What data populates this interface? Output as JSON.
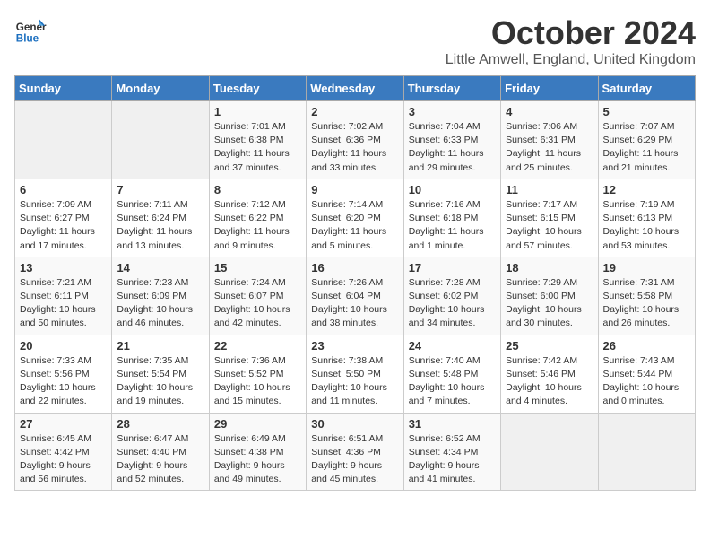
{
  "header": {
    "logo_line1": "General",
    "logo_line2": "Blue",
    "month": "October 2024",
    "location": "Little Amwell, England, United Kingdom"
  },
  "days_of_week": [
    "Sunday",
    "Monday",
    "Tuesday",
    "Wednesday",
    "Thursday",
    "Friday",
    "Saturday"
  ],
  "weeks": [
    [
      {
        "day": "",
        "info": ""
      },
      {
        "day": "",
        "info": ""
      },
      {
        "day": "1",
        "info": "Sunrise: 7:01 AM\nSunset: 6:38 PM\nDaylight: 11 hours and 37 minutes."
      },
      {
        "day": "2",
        "info": "Sunrise: 7:02 AM\nSunset: 6:36 PM\nDaylight: 11 hours and 33 minutes."
      },
      {
        "day": "3",
        "info": "Sunrise: 7:04 AM\nSunset: 6:33 PM\nDaylight: 11 hours and 29 minutes."
      },
      {
        "day": "4",
        "info": "Sunrise: 7:06 AM\nSunset: 6:31 PM\nDaylight: 11 hours and 25 minutes."
      },
      {
        "day": "5",
        "info": "Sunrise: 7:07 AM\nSunset: 6:29 PM\nDaylight: 11 hours and 21 minutes."
      }
    ],
    [
      {
        "day": "6",
        "info": "Sunrise: 7:09 AM\nSunset: 6:27 PM\nDaylight: 11 hours and 17 minutes."
      },
      {
        "day": "7",
        "info": "Sunrise: 7:11 AM\nSunset: 6:24 PM\nDaylight: 11 hours and 13 minutes."
      },
      {
        "day": "8",
        "info": "Sunrise: 7:12 AM\nSunset: 6:22 PM\nDaylight: 11 hours and 9 minutes."
      },
      {
        "day": "9",
        "info": "Sunrise: 7:14 AM\nSunset: 6:20 PM\nDaylight: 11 hours and 5 minutes."
      },
      {
        "day": "10",
        "info": "Sunrise: 7:16 AM\nSunset: 6:18 PM\nDaylight: 11 hours and 1 minute."
      },
      {
        "day": "11",
        "info": "Sunrise: 7:17 AM\nSunset: 6:15 PM\nDaylight: 10 hours and 57 minutes."
      },
      {
        "day": "12",
        "info": "Sunrise: 7:19 AM\nSunset: 6:13 PM\nDaylight: 10 hours and 53 minutes."
      }
    ],
    [
      {
        "day": "13",
        "info": "Sunrise: 7:21 AM\nSunset: 6:11 PM\nDaylight: 10 hours and 50 minutes."
      },
      {
        "day": "14",
        "info": "Sunrise: 7:23 AM\nSunset: 6:09 PM\nDaylight: 10 hours and 46 minutes."
      },
      {
        "day": "15",
        "info": "Sunrise: 7:24 AM\nSunset: 6:07 PM\nDaylight: 10 hours and 42 minutes."
      },
      {
        "day": "16",
        "info": "Sunrise: 7:26 AM\nSunset: 6:04 PM\nDaylight: 10 hours and 38 minutes."
      },
      {
        "day": "17",
        "info": "Sunrise: 7:28 AM\nSunset: 6:02 PM\nDaylight: 10 hours and 34 minutes."
      },
      {
        "day": "18",
        "info": "Sunrise: 7:29 AM\nSunset: 6:00 PM\nDaylight: 10 hours and 30 minutes."
      },
      {
        "day": "19",
        "info": "Sunrise: 7:31 AM\nSunset: 5:58 PM\nDaylight: 10 hours and 26 minutes."
      }
    ],
    [
      {
        "day": "20",
        "info": "Sunrise: 7:33 AM\nSunset: 5:56 PM\nDaylight: 10 hours and 22 minutes."
      },
      {
        "day": "21",
        "info": "Sunrise: 7:35 AM\nSunset: 5:54 PM\nDaylight: 10 hours and 19 minutes."
      },
      {
        "day": "22",
        "info": "Sunrise: 7:36 AM\nSunset: 5:52 PM\nDaylight: 10 hours and 15 minutes."
      },
      {
        "day": "23",
        "info": "Sunrise: 7:38 AM\nSunset: 5:50 PM\nDaylight: 10 hours and 11 minutes."
      },
      {
        "day": "24",
        "info": "Sunrise: 7:40 AM\nSunset: 5:48 PM\nDaylight: 10 hours and 7 minutes."
      },
      {
        "day": "25",
        "info": "Sunrise: 7:42 AM\nSunset: 5:46 PM\nDaylight: 10 hours and 4 minutes."
      },
      {
        "day": "26",
        "info": "Sunrise: 7:43 AM\nSunset: 5:44 PM\nDaylight: 10 hours and 0 minutes."
      }
    ],
    [
      {
        "day": "27",
        "info": "Sunrise: 6:45 AM\nSunset: 4:42 PM\nDaylight: 9 hours and 56 minutes."
      },
      {
        "day": "28",
        "info": "Sunrise: 6:47 AM\nSunset: 4:40 PM\nDaylight: 9 hours and 52 minutes."
      },
      {
        "day": "29",
        "info": "Sunrise: 6:49 AM\nSunset: 4:38 PM\nDaylight: 9 hours and 49 minutes."
      },
      {
        "day": "30",
        "info": "Sunrise: 6:51 AM\nSunset: 4:36 PM\nDaylight: 9 hours and 45 minutes."
      },
      {
        "day": "31",
        "info": "Sunrise: 6:52 AM\nSunset: 4:34 PM\nDaylight: 9 hours and 41 minutes."
      },
      {
        "day": "",
        "info": ""
      },
      {
        "day": "",
        "info": ""
      }
    ]
  ]
}
